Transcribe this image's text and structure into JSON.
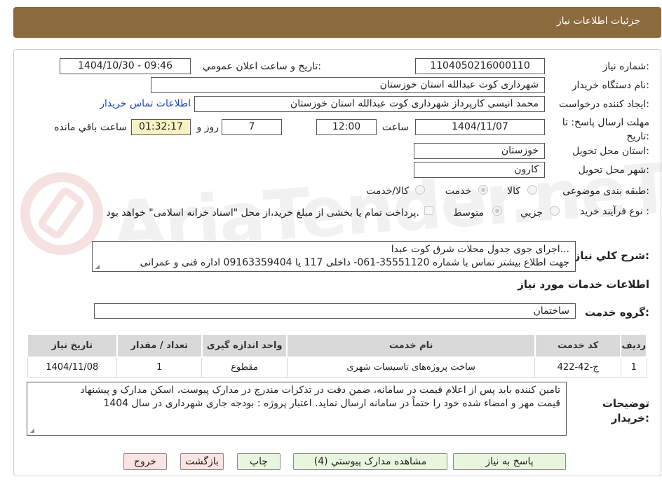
{
  "header": {
    "title": "جزئیات اطلاعات نیاز"
  },
  "fields": {
    "need_number_label": "شماره نیاز:",
    "need_number": "1104050216000110",
    "announce_label": "تاریخ و ساعت اعلان عمومي:",
    "announce_value": "1404/10/30 - 09:46",
    "buyer_org_label": "نام دستگاه خریدار:",
    "buyer_org": "شهرداری کوت عبدالله استان خوزستان",
    "creator_label": "ایجاد کننده درخواست:",
    "creator": "محمد انیسی کارپرداز شهرداری کوت عبدالله استان خوزستان",
    "contact_link": "اطلاعات تماس خریدار",
    "deadline_label": "مهلت ارسال پاسخ: تا تاریخ:",
    "deadline_date": "1404/11/07",
    "time_label": "ساعت",
    "deadline_time": "12:00",
    "days_value": "7",
    "days_label": "روز و",
    "remaining_time": "01:32:17",
    "remaining_label": "ساعت باقي مانده",
    "province_label": "استان محل تحویل:",
    "province": "خوزستان",
    "city_label": "شهر محل تحویل:",
    "city": "کارون",
    "category_label": "طبقه بندی موضوعی:",
    "category_options": [
      "کالا",
      "خدمت",
      "کالا/خدمت"
    ],
    "process_label": "نوع فرآیند خرید :",
    "process_options": [
      "جزیي",
      "متوسط"
    ],
    "payment_note": "پرداخت تمام یا بخشی از مبلغ خرید،از محل \"اسناد خزانه اسلامی\" خواهد بود."
  },
  "description": {
    "label": "شرح کلي نیاز:",
    "line1": "اجرای جوی جدول محلات شرق کوت عبدا...",
    "line2": "جهت اطلاع بیشتر تماس با شماره 35551120-061- داخلی 117 یا 09163359404 اداره فنی و عمرانی"
  },
  "services": {
    "section_title": "اطلاعات خدمات مورد نیاز",
    "group_label": "گروه خدمت:",
    "group_value": "ساختمان",
    "columns": [
      "ردیف",
      "کد خدمت",
      "نام خدمت",
      "واحد اندازه گیری",
      "تعداد / مقدار",
      "تاریخ نیاز"
    ],
    "rows": [
      {
        "row": "1",
        "code": "ج-42-422",
        "name": "ساخت پروژه‌های تاسیسات شهری",
        "unit": "مقطوع",
        "qty": "1",
        "date": "1404/11/08"
      }
    ]
  },
  "buyer_notes": {
    "label": "توضیحات خریدار:",
    "line1": "تامین کننده باید پس از اعلام قیمت در سامانه، ضمن دقت در تذکرات مندرج در مدارک پیوست، اسکن مدارک و پیشنهاد",
    "line2": "قیمت مهر و امضاء شده خود را حتماً در سامانه ارسال نماید. اعتبار پروژه : بودجه جاری شهرداری در سال 1404"
  },
  "buttons": {
    "respond": "پاسخ به نیاز",
    "attachments": "مشاهده مدارک پیوستي (4)",
    "print": "چاپ",
    "back": "بازگشت",
    "exit": "خروج"
  },
  "watermark": "AriaTender.neT",
  "colors": {
    "header": "#8b6a3e",
    "remaining_bg": "#f6f2c3",
    "link": "#1a45b8",
    "btn_green": "#e8f5df",
    "btn_pink": "#fbe3e3"
  }
}
